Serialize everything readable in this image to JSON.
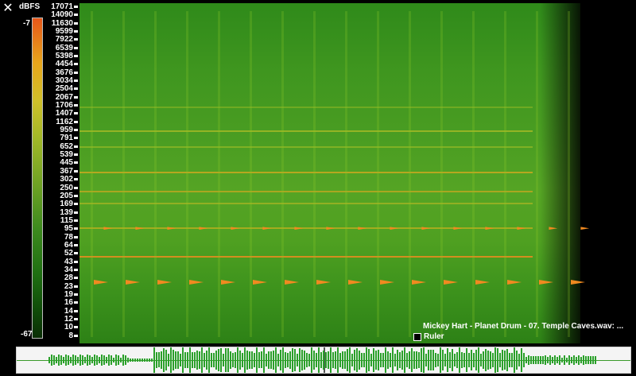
{
  "window": {
    "close_symbol": "✕"
  },
  "colorbar": {
    "unit_label": "dBFS",
    "max_label": "-7",
    "min_label": "-67"
  },
  "freq_axis": {
    "labels": [
      "17071",
      "14090",
      "11630",
      "9599",
      "7922",
      "6539",
      "5398",
      "4454",
      "3676",
      "3034",
      "2504",
      "2067",
      "1706",
      "1407",
      "1162",
      "959",
      "791",
      "652",
      "539",
      "445",
      "367",
      "302",
      "250",
      "205",
      "169",
      "139",
      "115",
      "95",
      "78",
      "64",
      "52",
      "43",
      "34",
      "28",
      "23",
      "19",
      "16",
      "14",
      "12",
      "10",
      "8"
    ]
  },
  "file_info": {
    "title": "Mickey Hart - Planet Drum - 07. Temple Caves.wav: ..."
  },
  "ruler": {
    "label": "Ruler",
    "checked": false
  },
  "colors": {
    "background": "#000000",
    "spectrum_high": "#e8571a",
    "spectrum_mid": "#cfc02a",
    "spectrum_low": "#2f8a1a",
    "waveform": "#2aa02a"
  }
}
